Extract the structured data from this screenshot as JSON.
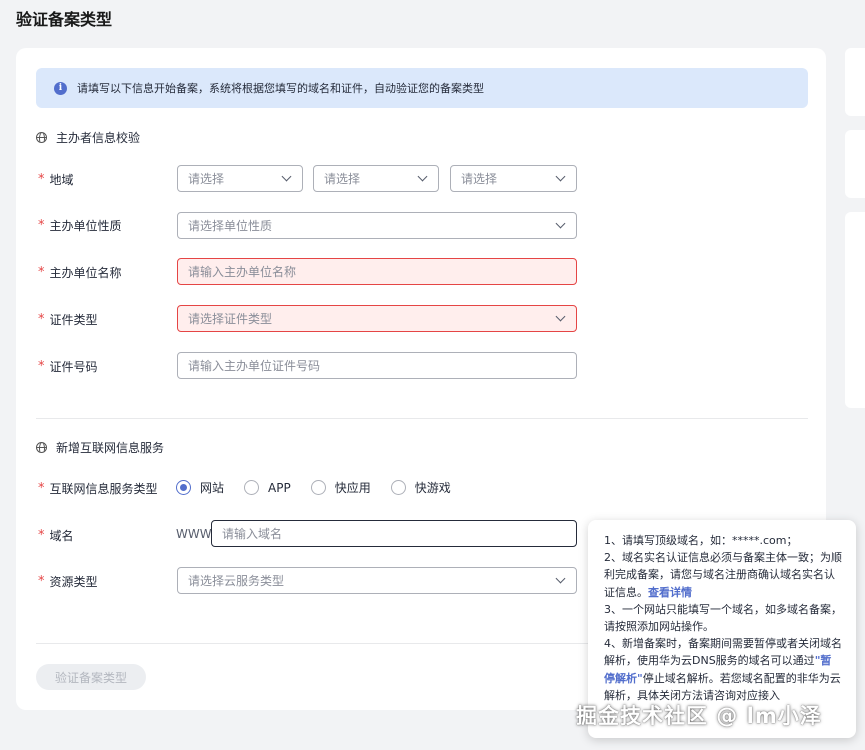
{
  "page": {
    "title": "验证备案类型"
  },
  "notice": {
    "text": "请填写以下信息开始备案，系统将根据您填写的域名和证件，自动验证您的备案类型"
  },
  "sponsor_section": {
    "title": "主办者信息校验",
    "region": {
      "label": "地域",
      "selects": [
        "请选择",
        "请选择",
        "请选择"
      ]
    },
    "unit_nature": {
      "label": "主办单位性质",
      "placeholder": "请选择单位性质"
    },
    "unit_name": {
      "label": "主办单位名称",
      "placeholder": "请输入主办单位名称"
    },
    "cert_type": {
      "label": "证件类型",
      "placeholder": "请选择证件类型"
    },
    "cert_number": {
      "label": "证件号码",
      "placeholder": "请输入主办单位证件号码"
    }
  },
  "service_section": {
    "title": "新增互联网信息服务",
    "service_type": {
      "label": "互联网信息服务类型",
      "options": [
        "网站",
        "APP",
        "快应用",
        "快游戏"
      ],
      "selected": "网站"
    },
    "domain": {
      "label": "域名",
      "prefix": "WWW",
      "placeholder": "请输入域名"
    },
    "resource_type": {
      "label": "资源类型",
      "placeholder": "请选择云服务类型"
    }
  },
  "submit": {
    "label": "验证备案类型"
  },
  "tooltip": {
    "line1": "1、请填写顶级域名，如：*****.com；",
    "line2": "2、域名实名认证信息必须与备案主体一致；为顺利完成备案，请您与域名注册商确认域名实名认证信息。",
    "line2_link": "查看详情",
    "line3": "3、一个网站只能填写一个域名，如多域名备案，请按照添加网站操作。",
    "line4_a": "4、新增备案时，备案期间需要暂停或者关闭域名解析，使用华为云DNS服务的域名可以通过",
    "line4_link": "\"暂停解析\"",
    "line4_b": "停止域名解析。若您域名配置的非华为云解析，具体关闭方法请咨询对应接入"
  },
  "watermark": "掘金技术社区 @ lm小泽",
  "colors": {
    "accent": "#526ecc",
    "required": "#e54545",
    "error_bg": "#ffeeed",
    "notice_bg": "#dbe8fb"
  }
}
